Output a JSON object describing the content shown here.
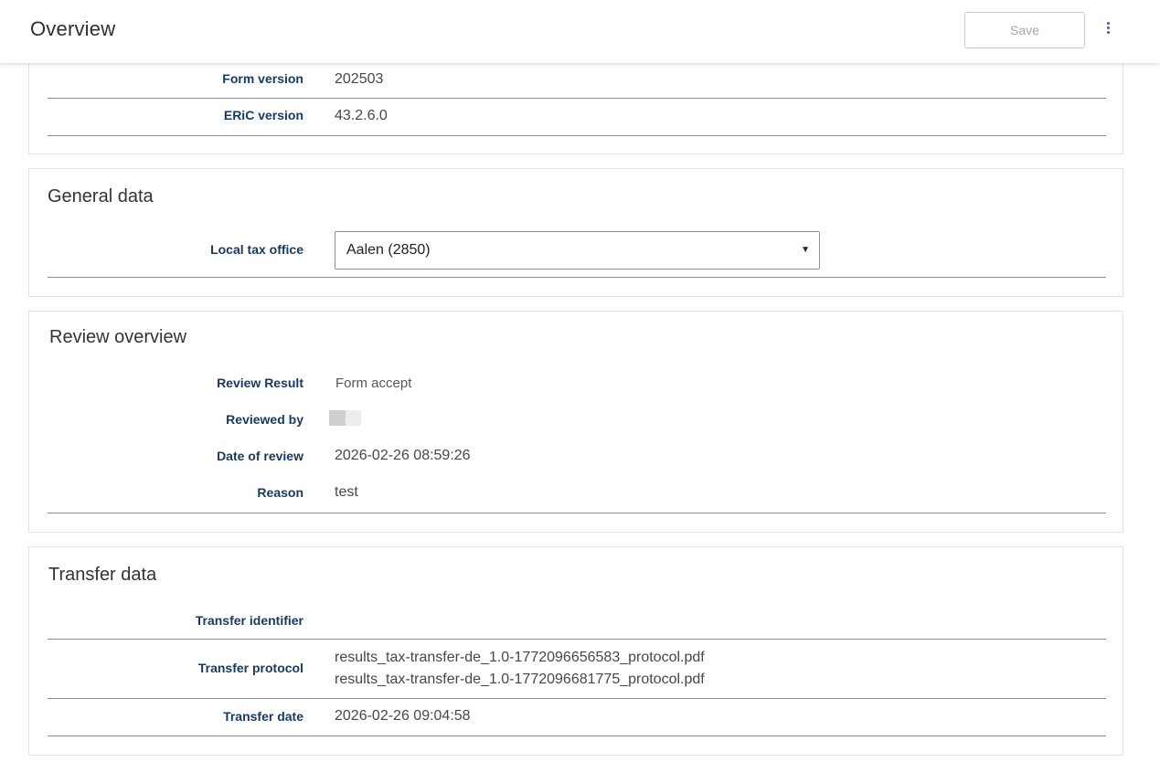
{
  "header": {
    "title": "Overview",
    "save_label": "Save",
    "more_icon": "more-vert-icon",
    "accent_color": "#7a3fa0"
  },
  "version_section": {
    "rows": [
      {
        "label": "Form version",
        "value": "202503"
      },
      {
        "label": "ERiC version",
        "value": "43.2.6.0"
      }
    ]
  },
  "general_data": {
    "title": "General data",
    "local_tax_office": {
      "label": "Local tax office",
      "selected": "Aalen (2850)",
      "caret_icon": "dropdown-caret-icon"
    }
  },
  "review_overview": {
    "title": "Review overview",
    "review_result": {
      "label": "Review Result",
      "value": "Form accept"
    },
    "reviewed_by": {
      "label": "Reviewed by",
      "avatar_icon": "user-avatar-icon"
    },
    "date_of_review": {
      "label": "Date of review",
      "value": "2026-02-26 08:59:26"
    },
    "reason": {
      "label": "Reason",
      "value": "test"
    }
  },
  "transfer_data": {
    "title": "Transfer data",
    "transfer_identifier": {
      "label": "Transfer identifier",
      "value": ""
    },
    "transfer_protocol": {
      "label": "Transfer protocol",
      "files": [
        "results_tax-transfer-de_1.0-1772096656583_protocol.pdf",
        "results_tax-transfer-de_1.0-1772096681775_protocol.pdf"
      ]
    },
    "transfer_date": {
      "label": "Transfer date",
      "value": "2026-02-26 09:04:58"
    }
  }
}
